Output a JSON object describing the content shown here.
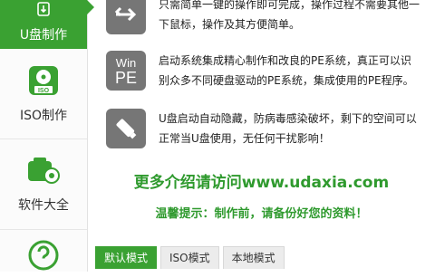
{
  "sidebar": {
    "items": [
      {
        "label": "U盘制作",
        "icon": "usb-icon",
        "active": true
      },
      {
        "label": "ISO制作",
        "icon": "iso-disc-icon",
        "active": false
      },
      {
        "label": "软件大全",
        "icon": "software-box-icon",
        "active": false
      },
      {
        "label": "",
        "icon": "help-icon",
        "active": false
      }
    ]
  },
  "features": [
    {
      "icon": "usb-arrows-icon",
      "text": "只需简单一键的操作即可完成，操作过程不需要其他一下鼠标，操作及其方便简单。"
    },
    {
      "icon": "winpe-icon",
      "icon_text_1": "Win",
      "icon_text_2": "PE",
      "text": "启动系统集成精心制作和改良的PE系统，真正可以识别众多不同硬盘驱动的PE系统，集成使用的PE程序。"
    },
    {
      "icon": "usb-drive-icon",
      "text": "U盘启动自动隐藏，防病毒感染破坏，剩下的空间可以正常当U盘使用，无任何干扰影响！"
    }
  ],
  "promo": {
    "link_text": "更多介绍请访问www.udaxia.com",
    "warning": "温馨提示：制作前，请备份好您的资料！"
  },
  "tabs": [
    {
      "label": "默认模式",
      "active": true
    },
    {
      "label": "ISO模式",
      "active": false
    },
    {
      "label": "本地模式",
      "active": false
    }
  ],
  "colors": {
    "accent": "#3aa132",
    "icon_bg": "#767676"
  }
}
